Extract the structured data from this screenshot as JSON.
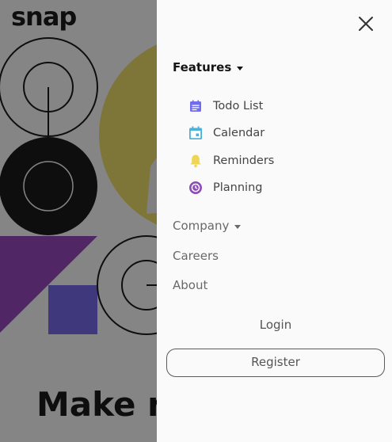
{
  "brand": {
    "logo": "snap"
  },
  "hero": {
    "headline": "Make re"
  },
  "menu": {
    "close_icon": "close-icon",
    "features": {
      "label": "Features",
      "expanded": true,
      "items": [
        {
          "label": "Todo List",
          "icon": "todo-list-icon",
          "color": "#726CEE"
        },
        {
          "label": "Calendar",
          "icon": "calendar-icon",
          "color": "#4BB1DA"
        },
        {
          "label": "Reminders",
          "icon": "bell-icon",
          "color": "#EDD556"
        },
        {
          "label": "Planning",
          "icon": "planning-icon",
          "color": "#8E4CB6"
        }
      ]
    },
    "company": {
      "label": "Company",
      "expanded": false
    },
    "careers": "Careers",
    "about": "About",
    "login": "Login",
    "register": "Register"
  }
}
